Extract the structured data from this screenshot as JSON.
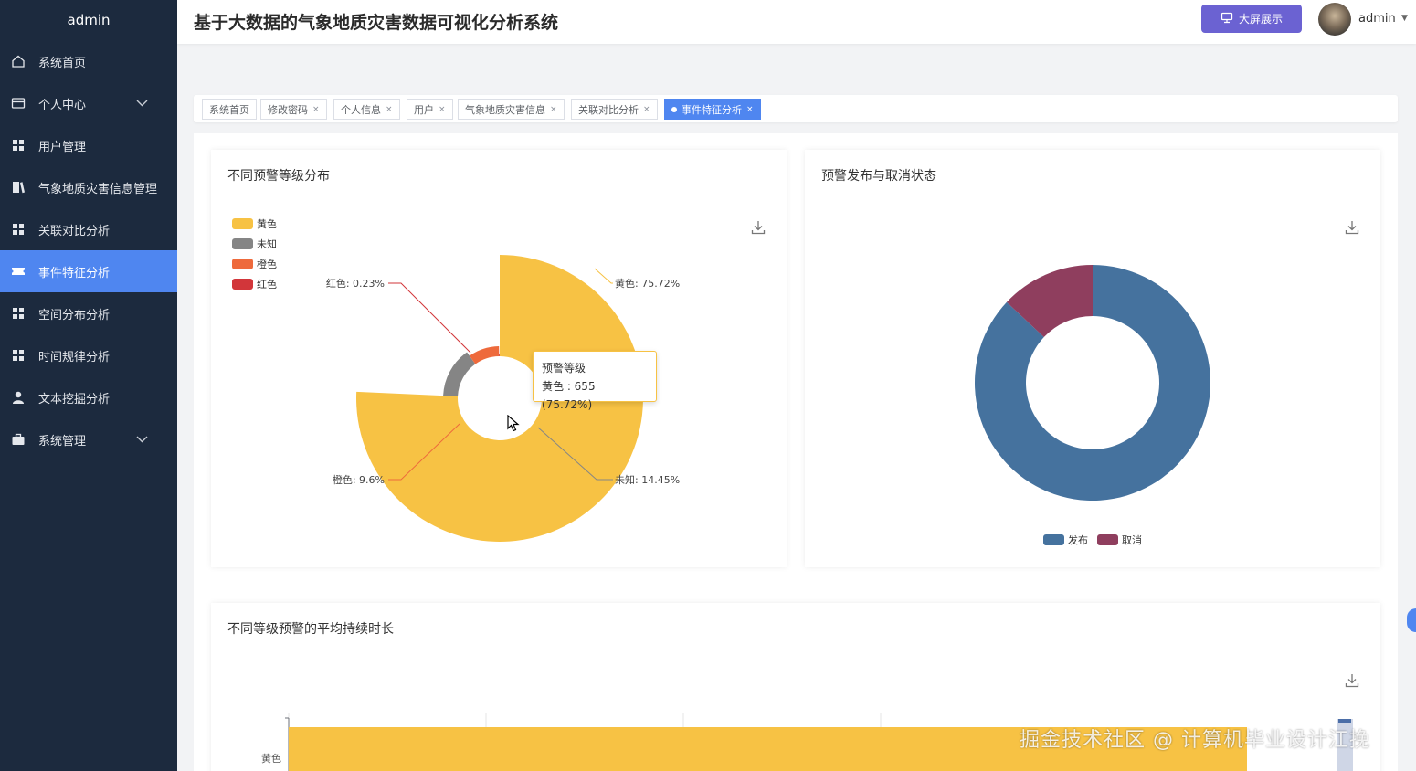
{
  "sidebar": {
    "title": "admin",
    "items": [
      {
        "label": "系统首页",
        "icon": "home-icon"
      },
      {
        "label": "个人中心",
        "icon": "profile-icon"
      },
      {
        "label": "用户管理",
        "icon": "grid-icon"
      },
      {
        "label": "气象地质灾害信息管理",
        "icon": "library-icon"
      },
      {
        "label": "关联对比分析",
        "icon": "grid-icon"
      },
      {
        "label": "事件特征分析",
        "icon": "ticket-icon"
      },
      {
        "label": "空间分布分析",
        "icon": "grid-icon"
      },
      {
        "label": "时间规律分析",
        "icon": "grid-icon"
      },
      {
        "label": "文本挖掘分析",
        "icon": "user-icon"
      },
      {
        "label": "系统管理",
        "icon": "briefcase-icon"
      }
    ],
    "active_index": 5
  },
  "header": {
    "title": "基于大数据的气象地质灾害数据可视化分析系统",
    "bigscreen_label": "大屏展示",
    "username": "admin"
  },
  "tags": [
    {
      "label": "系统首页"
    },
    {
      "label": "修改密码"
    },
    {
      "label": "个人信息"
    },
    {
      "label": "用户"
    },
    {
      "label": "气象地质灾害信息"
    },
    {
      "label": "关联对比分析"
    },
    {
      "label": "事件特征分析",
      "active": true
    }
  ],
  "colors": {
    "yellow": "#f7c244",
    "gray": "#858585",
    "orange": "#ee6a3c",
    "red": "#d2363a",
    "blue": "#45729e",
    "crimson": "#8f3e5e",
    "accent": "#4f86f0"
  },
  "chart_data": [
    {
      "type": "pie",
      "title": "不同预警等级分布",
      "legend_position": "top-left",
      "slices": [
        {
          "name": "黄色",
          "percent": 75.72,
          "value": 655,
          "label": "黄色: 75.72%"
        },
        {
          "name": "未知",
          "percent": 14.45,
          "label": "未知: 14.45%"
        },
        {
          "name": "橙色",
          "percent": 9.6,
          "label": "橙色: 9.6%"
        },
        {
          "name": "红色",
          "percent": 0.23,
          "label": "红色: 0.23%"
        }
      ],
      "tooltip": {
        "title": "预警等级",
        "text": "黄色 : 655 (75.72%)"
      }
    },
    {
      "type": "pie",
      "title": "预警发布与取消状态",
      "legend_position": "bottom-center",
      "slices": [
        {
          "name": "发布",
          "percent": 87
        },
        {
          "name": "取消",
          "percent": 13
        }
      ]
    },
    {
      "type": "bar",
      "title": "不同等级预警的平均持续时长",
      "orientation": "horizontal",
      "categories": [
        "黄色"
      ],
      "bar_fraction": 0.81
    }
  ],
  "watermark": "掘金技术社区 @ 计算机毕业设计江挽"
}
